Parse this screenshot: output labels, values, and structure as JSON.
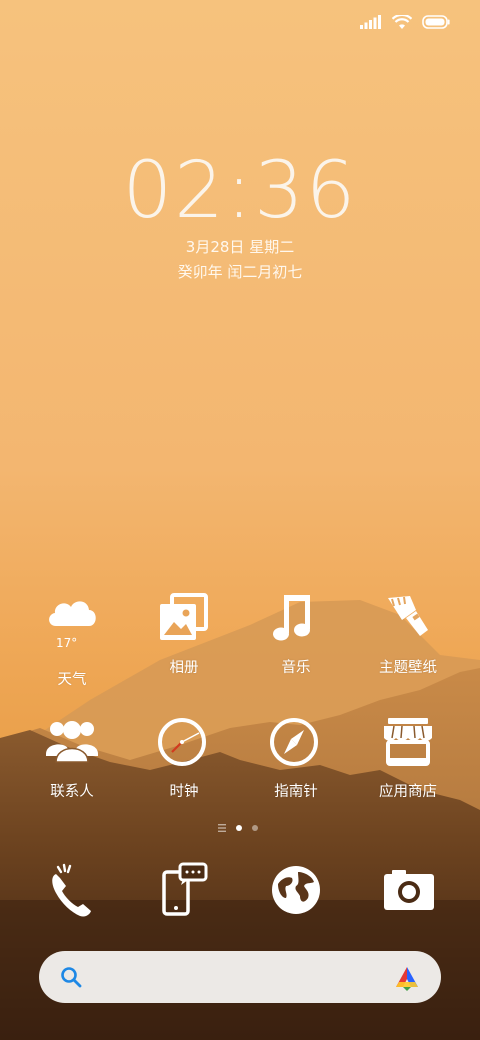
{
  "status_bar": {
    "signal_icon": "signal-bars-icon",
    "wifi_icon": "wifi-icon",
    "battery_icon": "battery-icon"
  },
  "clock": {
    "time": "02:36",
    "date": "3月28日 星期二",
    "lunar": "癸卯年 闰二月初七"
  },
  "apps": [
    {
      "id": "weather",
      "label": "天气",
      "icon": "cloud-icon",
      "extra": "17°"
    },
    {
      "id": "gallery",
      "label": "相册",
      "icon": "photo-album-icon"
    },
    {
      "id": "music",
      "label": "音乐",
      "icon": "music-note-icon"
    },
    {
      "id": "themes",
      "label": "主题壁纸",
      "icon": "paint-brush-icon"
    },
    {
      "id": "contacts",
      "label": "联系人",
      "icon": "people-icon"
    },
    {
      "id": "clock",
      "label": "时钟",
      "icon": "clock-icon"
    },
    {
      "id": "compass",
      "label": "指南针",
      "icon": "compass-icon"
    },
    {
      "id": "store",
      "label": "应用商店",
      "icon": "store-icon"
    }
  ],
  "page_indicator": {
    "pages": 2,
    "active": 0
  },
  "dock": [
    {
      "id": "phone",
      "icon": "phone-icon"
    },
    {
      "id": "messages",
      "icon": "messages-phone-icon"
    },
    {
      "id": "browser",
      "icon": "globe-icon"
    },
    {
      "id": "camera",
      "icon": "camera-icon"
    }
  ],
  "search": {
    "search_icon": "search-icon",
    "assistant_icon": "assistant-logo-icon",
    "accent_color": "#1e88e5"
  },
  "colors": {
    "sky_top": "#f6c27e",
    "sky_mid": "#f0b26a",
    "ground_dark": "#3d2312"
  }
}
